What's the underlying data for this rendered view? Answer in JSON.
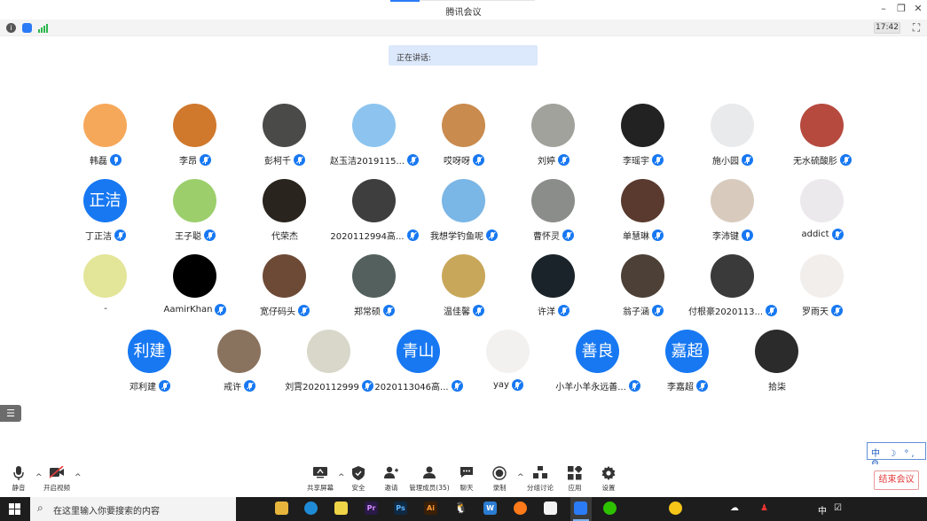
{
  "window": {
    "title": "腾讯会议"
  },
  "status_bar": {
    "time": "17:42"
  },
  "speaking": {
    "label": "正在讲话:"
  },
  "participants": [
    {
      "name": "韩磊",
      "avatar": "photo",
      "color": "#f6a85a",
      "mic": "active"
    },
    {
      "name": "李昂",
      "avatar": "photo",
      "color": "#d0782c",
      "mic": "muted"
    },
    {
      "name": "彭柯千",
      "avatar": "photo",
      "color": "#4a4a48",
      "mic": "muted"
    },
    {
      "name": "赵玉洁2019115...",
      "avatar": "photo",
      "color": "#8cc4ef",
      "mic": "muted"
    },
    {
      "name": "哎呀呀",
      "avatar": "photo",
      "color": "#c98b4e",
      "mic": "muted"
    },
    {
      "name": "刘婷",
      "avatar": "photo",
      "color": "#a2a29c",
      "mic": "muted"
    },
    {
      "name": "李瑶宇",
      "avatar": "photo",
      "color": "#222222",
      "mic": "muted"
    },
    {
      "name": "施小园",
      "avatar": "photo",
      "color": "#e8eaec",
      "mic": "muted"
    },
    {
      "name": "无水硫酸肜",
      "avatar": "photo",
      "color": "#b64a3f",
      "mic": "muted"
    },
    {
      "name": "丁正洁",
      "avatar": "text",
      "text": "正洁",
      "mic": "muted"
    },
    {
      "name": "王子聪",
      "avatar": "photo",
      "color": "#9ccf6c",
      "mic": "muted"
    },
    {
      "name": "代荣杰",
      "avatar": "photo",
      "color": "#2a241e",
      "mic": "none"
    },
    {
      "name": "2020112994高...",
      "avatar": "photo",
      "color": "#3e3e3e",
      "mic": "muted"
    },
    {
      "name": "我想学钓鱼呢",
      "avatar": "photo",
      "color": "#7ab6e6",
      "mic": "muted"
    },
    {
      "name": "曹怀灵",
      "avatar": "photo",
      "color": "#8b8d8a",
      "mic": "muted"
    },
    {
      "name": "单慧琳",
      "avatar": "photo",
      "color": "#5a3a2e",
      "mic": "muted"
    },
    {
      "name": "李沛键",
      "avatar": "photo",
      "color": "#d8cbbe",
      "mic": "active"
    },
    {
      "name": "addict",
      "avatar": "photo",
      "color": "#ece9ec",
      "mic": "muted"
    },
    {
      "name": "-",
      "avatar": "photo",
      "color": "#e3e598",
      "mic": "none"
    },
    {
      "name": "AamirKhan",
      "avatar": "photo",
      "color": "#000000",
      "mic": "muted"
    },
    {
      "name": "宽仔码头",
      "avatar": "photo",
      "color": "#6d4a36",
      "mic": "muted"
    },
    {
      "name": "郑常硕",
      "avatar": "photo",
      "color": "#53605e",
      "mic": "muted"
    },
    {
      "name": "温佳馨",
      "avatar": "photo",
      "color": "#c8a75a",
      "mic": "muted"
    },
    {
      "name": "许洋",
      "avatar": "photo",
      "color": "#1a2329",
      "mic": "muted"
    },
    {
      "name": "翁子涵",
      "avatar": "photo",
      "color": "#4d4036",
      "mic": "muted"
    },
    {
      "name": "付根豪2020113...",
      "avatar": "photo",
      "color": "#3a3a3a",
      "mic": "muted"
    },
    {
      "name": "罗雨天",
      "avatar": "photo",
      "color": "#f1eeec",
      "mic": "muted"
    },
    {
      "name": "邓利建",
      "avatar": "text",
      "text": "利建",
      "mic": "muted"
    },
    {
      "name": "戒许",
      "avatar": "photo",
      "color": "#8a735e",
      "mic": "muted"
    },
    {
      "name": "刘霄2020112999",
      "avatar": "photo",
      "color": "#d8d7c9",
      "mic": "muted"
    },
    {
      "name": "2020113046高...",
      "avatar": "text",
      "text": "青山",
      "mic": "muted"
    },
    {
      "name": "yay",
      "avatar": "photo",
      "color": "#f3f1f0",
      "mic": "muted"
    },
    {
      "name": "小羊小羊永远善...",
      "avatar": "text",
      "text": "善良",
      "mic": "muted"
    },
    {
      "name": "李嘉超",
      "avatar": "text",
      "text": "嘉超",
      "mic": "muted"
    },
    {
      "name": "拾柒",
      "avatar": "photo",
      "color": "#2b2b2b",
      "mic": "none"
    }
  ],
  "ime": {
    "label": "中 ☽ °, ⚙"
  },
  "toolbar": {
    "items": [
      {
        "id": "mute",
        "label": "静音",
        "icon": "microphone-icon"
      },
      {
        "id": "video",
        "label": "开启视频",
        "icon": "video-off-icon"
      },
      {
        "id": "share",
        "label": "共享屏幕",
        "icon": "share-screen-icon"
      },
      {
        "id": "security",
        "label": "安全",
        "icon": "shield-icon"
      },
      {
        "id": "invite",
        "label": "邀请",
        "icon": "add-user-icon"
      },
      {
        "id": "members",
        "label": "管理成员(35)",
        "icon": "members-icon"
      },
      {
        "id": "chat",
        "label": "聊天",
        "icon": "chat-icon"
      },
      {
        "id": "record",
        "label": "录制",
        "icon": "record-icon"
      },
      {
        "id": "breakout",
        "label": "分组讨论",
        "icon": "breakout-icon"
      },
      {
        "id": "apps",
        "label": "应用",
        "icon": "apps-icon"
      },
      {
        "id": "settings",
        "label": "设置",
        "icon": "gear-icon"
      }
    ],
    "end_label": "结束会议"
  },
  "taskbar": {
    "search_placeholder": "在这里输入你要搜索的内容",
    "ime_indicator": "中"
  }
}
